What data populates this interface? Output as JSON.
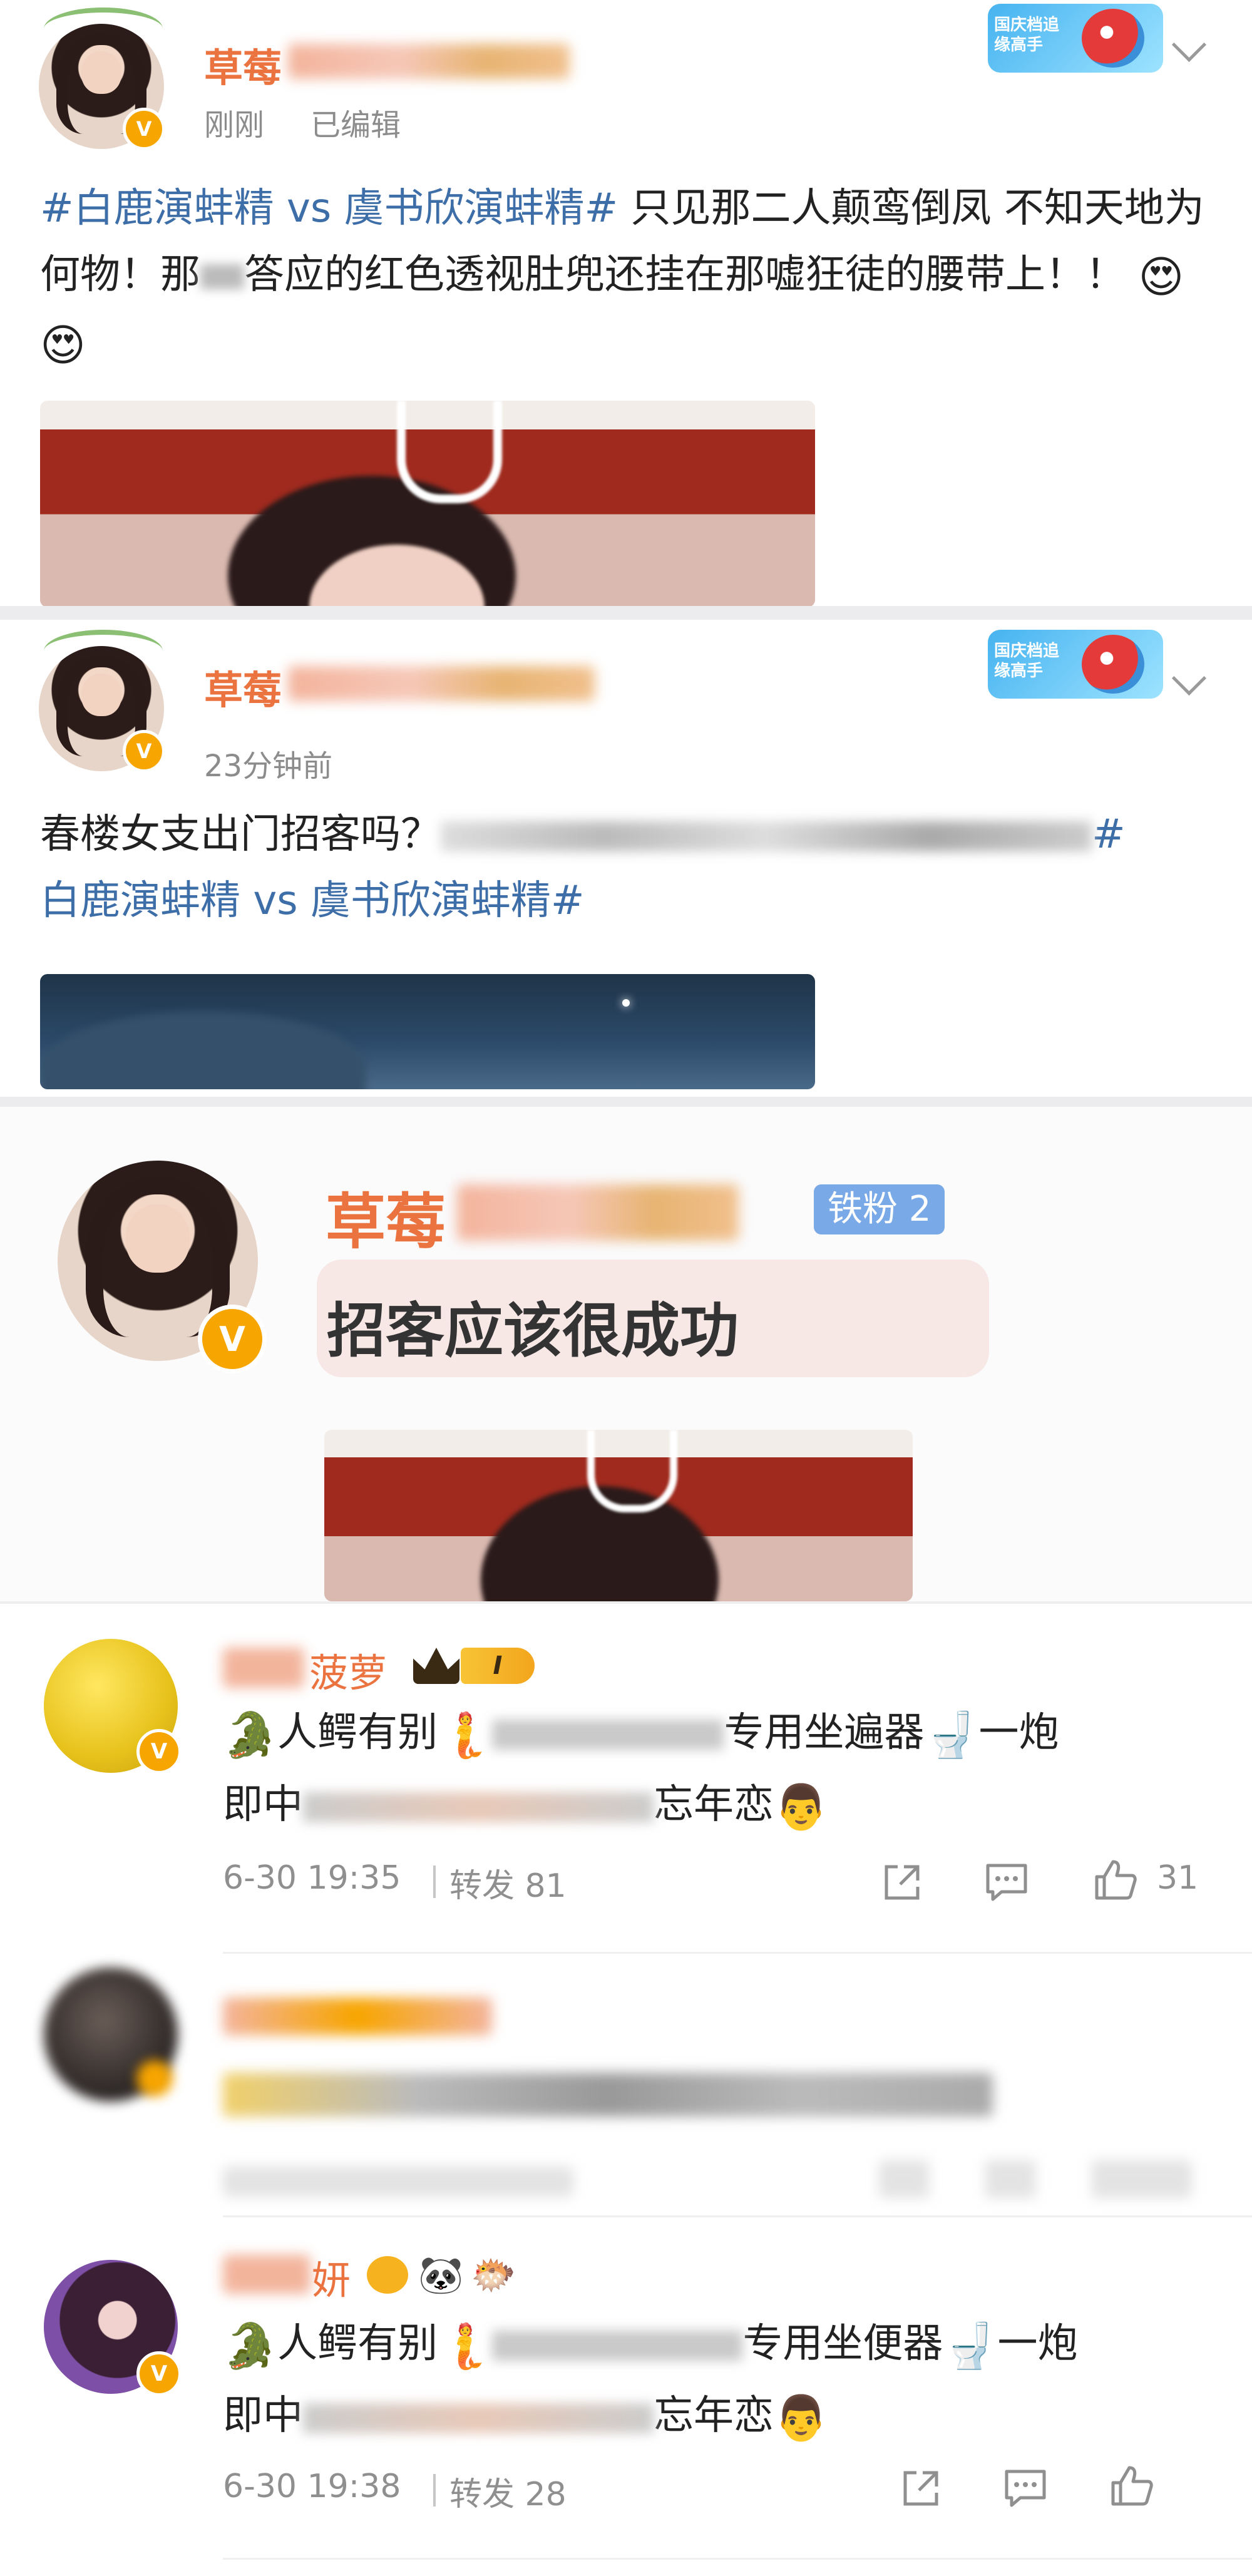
{
  "post1": {
    "name": "草莓",
    "time": "刚刚",
    "edited": "已编辑",
    "text_topic": "#白鹿演蚌精 vs 虞书欣演蚌精#",
    "text_a": " 只见那二人颠鸾倒凤 不知天地为何物！那",
    "text_b": "答应的红色透视肚兜还挂在那嘘狂徒的腰带上！！",
    "emojis": "😍😍",
    "badge": "国庆档追缘高手",
    "v_badge": "V"
  },
  "post2": {
    "name": "草莓",
    "time": "23分钟前",
    "text_a": "春楼女支出门招客吗？",
    "text_topic_end": "#",
    "text_topic": "白鹿演蚌精 vs 虞书欣演蚌精#",
    "badge": "国庆档追缘高手",
    "v_badge": "V"
  },
  "chat": {
    "name": "草莓",
    "fan_badge": "铁粉 2",
    "message": "招客应该很成功",
    "v_badge": "V"
  },
  "comments": [
    {
      "name": "菠萝",
      "level_badge": "I",
      "text_a": "人鳄有别",
      "text_b": "专用坐遍器",
      "text_c": "一炮",
      "text_d": "即中",
      "text_e": "忘年恋",
      "date": "6-30 19:35",
      "repost": "转发 81",
      "likes": "31",
      "v_badge": "V"
    },
    {
      "blurred": true
    },
    {
      "name": "妍",
      "text_a": "人鳄有别",
      "text_b": "专用坐便器",
      "text_c": "一炮",
      "text_d": "即中",
      "text_e": "忘年恋",
      "date": "6-30 19:38",
      "repost": "转发 28",
      "v_badge": "V"
    }
  ],
  "icons": {
    "share": "share-icon",
    "comment": "comment-icon",
    "like": "like-icon"
  },
  "colors": {
    "name_orange": "#eb7340",
    "topic_blue": "#3d6ea8",
    "meta_gray": "#8c8c8c",
    "verify_gold": "#f7a500",
    "fan_badge_blue": "#7aa9e8"
  }
}
